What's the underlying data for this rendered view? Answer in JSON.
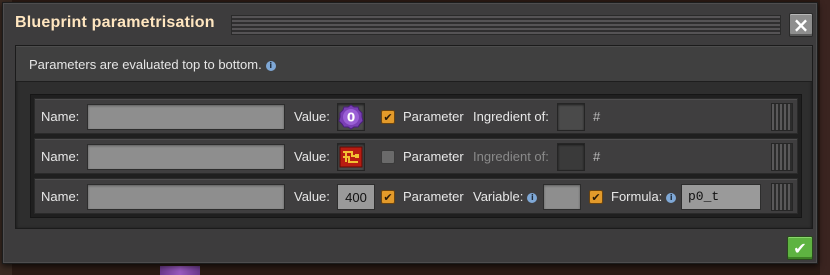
{
  "window": {
    "title": "Blueprint parametrisation"
  },
  "subheader": {
    "text": "Parameters are evaluated top to bottom.",
    "info_icon": "i"
  },
  "labels": {
    "name": "Name:",
    "value": "Value:",
    "parameter": "Parameter",
    "ingredient_of": "Ingredient of:",
    "variable": "Variable:",
    "formula": "Formula:",
    "hash": "#"
  },
  "rows": [
    {
      "name": "",
      "value_icon": "parameter-0-signal",
      "value_icon_text": "0",
      "parameter_checked": true,
      "ingredient_enabled": true
    },
    {
      "name": "",
      "value_icon": "item-recipe-icon",
      "parameter_checked": false,
      "ingredient_enabled": false
    },
    {
      "name": "",
      "value": "400",
      "parameter_checked": true,
      "variable": "",
      "formula_checked": true,
      "formula": "p0_t"
    }
  ],
  "colors": {
    "title": "#ffe6c0",
    "checkbox_on": "#e39a2a",
    "confirm": "#5eb341",
    "parameter_icon": "#7a3fb5"
  },
  "buttons": {
    "close": "×",
    "confirm": "✔",
    "check": "✔"
  }
}
